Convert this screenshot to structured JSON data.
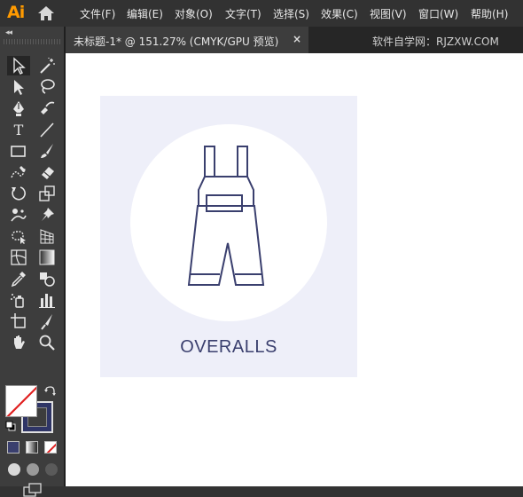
{
  "app": {
    "logo": "Ai",
    "menu": [
      "文件(F)",
      "编辑(E)",
      "对象(O)",
      "文字(T)",
      "选择(S)",
      "效果(C)",
      "视图(V)",
      "窗口(W)",
      "帮助(H)"
    ]
  },
  "document_tab": {
    "title": "未标题-1* @ 151.27% (CMYK/GPU 预览)",
    "close_glyph": "×"
  },
  "watermark": "软件自学网：RJZXW.COM",
  "toolbar": {
    "collapse_glyph": "◂◂",
    "tools": [
      "selection",
      "direct-selection",
      "magic-wand",
      "lasso",
      "pen",
      "curvature",
      "type",
      "line-segment",
      "rectangle",
      "paintbrush",
      "shaper",
      "eraser",
      "rotate",
      "scale",
      "puppet-warp",
      "pin",
      "free-transform",
      "perspective-grid",
      "mesh",
      "gradient",
      "eyedropper",
      "blend",
      "symbol-sprayer",
      "column-graph",
      "artboard",
      "slice",
      "hand",
      "zoom"
    ],
    "fill_color": "#ffffff",
    "stroke_color": "#2f3566"
  },
  "artwork": {
    "label": "OVERALLS",
    "card_color": "#eeeff9",
    "circle_color": "#ffffff",
    "stroke_color": "#3a3f6e"
  }
}
